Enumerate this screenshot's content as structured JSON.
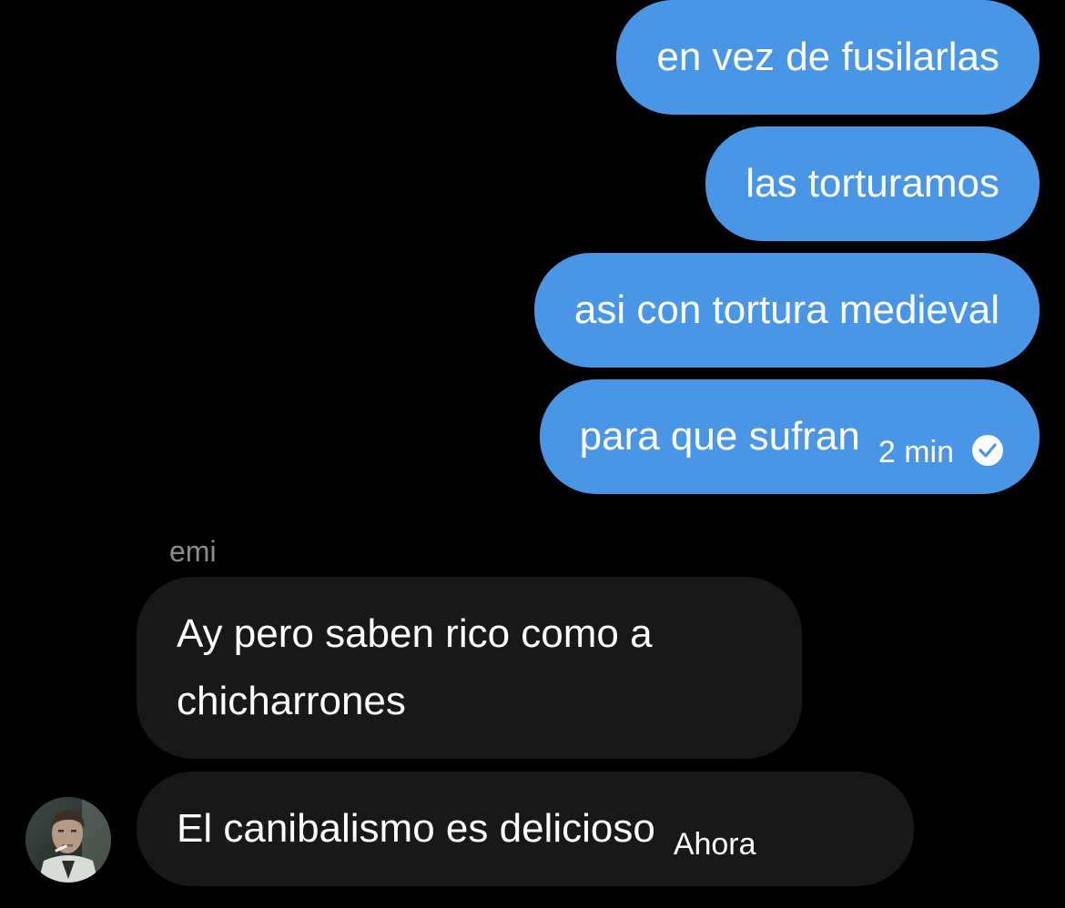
{
  "conversation": {
    "sent_messages": [
      {
        "text": "en vez de fusilarlas"
      },
      {
        "text": "las torturamos"
      },
      {
        "text": "asi con tortura medieval"
      },
      {
        "text": "para que sufran",
        "time": "2 min",
        "status_icon": "check-circle-icon"
      }
    ],
    "received": {
      "sender_name": "emi",
      "avatar_icon": "avatar",
      "messages": [
        {
          "text_line1": "Ay pero saben rico como a",
          "text_line2": "chicharrones"
        },
        {
          "text": "El canibalismo es delicioso",
          "time": "Ahora"
        }
      ]
    }
  },
  "colors": {
    "background": "#000000",
    "sent_bubble": "#4a96e6",
    "received_bubble": "#18181b",
    "sender_name": "#8b8b8f",
    "text": "#ffffff"
  }
}
